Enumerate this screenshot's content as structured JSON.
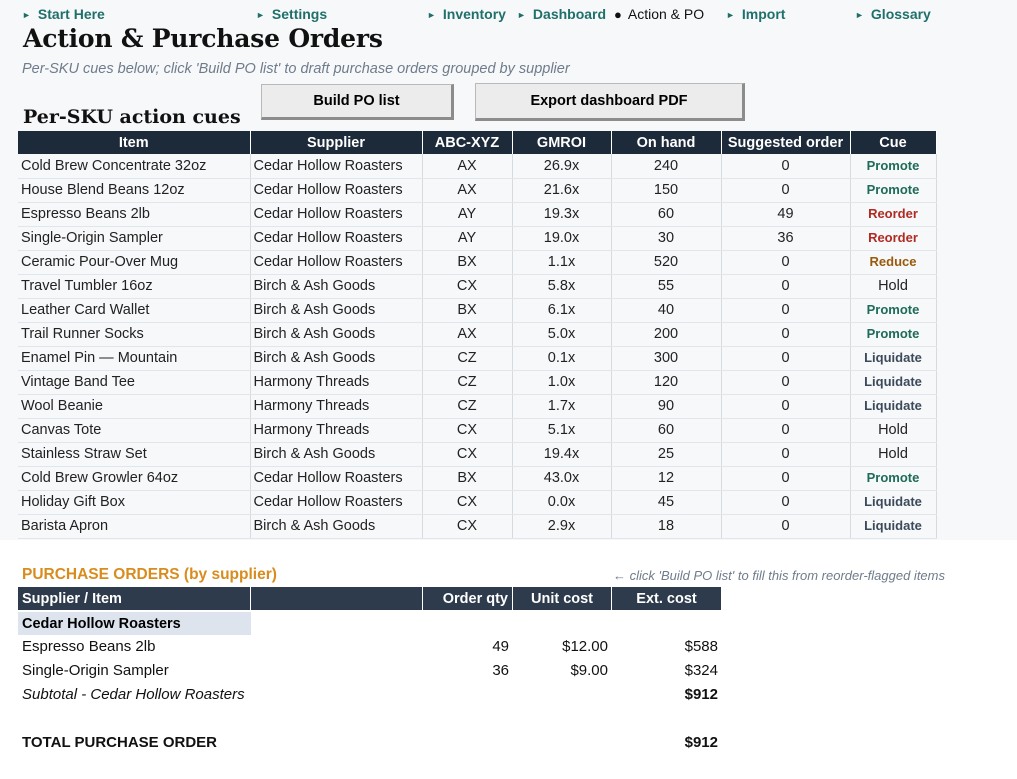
{
  "nav": [
    {
      "label": "Start Here",
      "active": false
    },
    {
      "label": "Settings",
      "active": false
    },
    {
      "label": "Inventory",
      "active": false
    },
    {
      "label": "Dashboard",
      "active": false
    },
    {
      "label": "Action & PO",
      "active": true
    },
    {
      "label": "Import",
      "active": false
    },
    {
      "label": "Glossary",
      "active": false
    }
  ],
  "page": {
    "title": "Action & Purchase Orders",
    "subtitle": "Per-SKU cues below; click 'Build PO list' to draft purchase orders grouped by supplier"
  },
  "buttons": {
    "build_po": "Build PO list",
    "export_pdf": "Export dashboard PDF"
  },
  "sku_section": {
    "title": "Per-SKU action cues",
    "columns": [
      "Item",
      "Supplier",
      "ABC-XYZ",
      "GMROI",
      "On hand",
      "Suggested order",
      "Cue"
    ],
    "rows": [
      [
        "Cold Brew Concentrate 32oz",
        "Cedar Hollow Roasters",
        "AX",
        "26.9x",
        "240",
        "0",
        "Promote"
      ],
      [
        "House Blend Beans 12oz",
        "Cedar Hollow Roasters",
        "AX",
        "21.6x",
        "150",
        "0",
        "Promote"
      ],
      [
        "Espresso Beans 2lb",
        "Cedar Hollow Roasters",
        "AY",
        "19.3x",
        "60",
        "49",
        "Reorder"
      ],
      [
        "Single-Origin Sampler",
        "Cedar Hollow Roasters",
        "AY",
        "19.0x",
        "30",
        "36",
        "Reorder"
      ],
      [
        "Ceramic Pour-Over Mug",
        "Cedar Hollow Roasters",
        "BX",
        "1.1x",
        "520",
        "0",
        "Reduce"
      ],
      [
        "Travel Tumbler 16oz",
        "Birch & Ash Goods",
        "CX",
        "5.8x",
        "55",
        "0",
        "Hold"
      ],
      [
        "Leather Card Wallet",
        "Birch & Ash Goods",
        "BX",
        "6.1x",
        "40",
        "0",
        "Promote"
      ],
      [
        "Trail Runner Socks",
        "Birch & Ash Goods",
        "AX",
        "5.0x",
        "200",
        "0",
        "Promote"
      ],
      [
        "Enamel Pin — Mountain",
        "Birch & Ash Goods",
        "CZ",
        "0.1x",
        "300",
        "0",
        "Liquidate"
      ],
      [
        "Vintage Band Tee",
        "Harmony Threads",
        "CZ",
        "1.0x",
        "120",
        "0",
        "Liquidate"
      ],
      [
        "Wool Beanie",
        "Harmony Threads",
        "CZ",
        "1.7x",
        "90",
        "0",
        "Liquidate"
      ],
      [
        "Canvas Tote",
        "Harmony Threads",
        "CX",
        "5.1x",
        "60",
        "0",
        "Hold"
      ],
      [
        "Stainless Straw Set",
        "Birch & Ash Goods",
        "CX",
        "19.4x",
        "25",
        "0",
        "Hold"
      ],
      [
        "Cold Brew Growler 64oz",
        "Cedar Hollow Roasters",
        "BX",
        "43.0x",
        "12",
        "0",
        "Promote"
      ],
      [
        "Holiday Gift Box",
        "Cedar Hollow Roasters",
        "CX",
        "0.0x",
        "45",
        "0",
        "Liquidate"
      ],
      [
        "Barista Apron",
        "Birch & Ash Goods",
        "CX",
        "2.9x",
        "18",
        "0",
        "Liquidate"
      ]
    ],
    "cue_colors": {
      "Promote": "#1e6b58",
      "Reorder": "#b02a22",
      "Reduce": "#9a5a0c",
      "Liquidate": "#3c4a5a",
      "Hold": "#222222"
    }
  },
  "purchase_orders": {
    "heading": "PURCHASE ORDERS (by supplier)",
    "hint": "← click 'Build PO list' to fill this from reorder-flagged items",
    "columns": [
      "Supplier / Item",
      "Order qty",
      "Unit cost",
      "Ext. cost"
    ],
    "groups": [
      {
        "supplier": "Cedar Hollow Roasters",
        "items": [
          {
            "name": "Espresso Beans 2lb",
            "qty": "49",
            "unit": "$12.00",
            "ext": "$588"
          },
          {
            "name": "Single-Origin Sampler",
            "qty": "36",
            "unit": "$9.00",
            "ext": "$324"
          }
        ],
        "subtotal_label": "Subtotal - Cedar Hollow Roasters",
        "subtotal": "$912"
      }
    ],
    "total_label": "TOTAL PURCHASE ORDER",
    "total": "$912"
  }
}
